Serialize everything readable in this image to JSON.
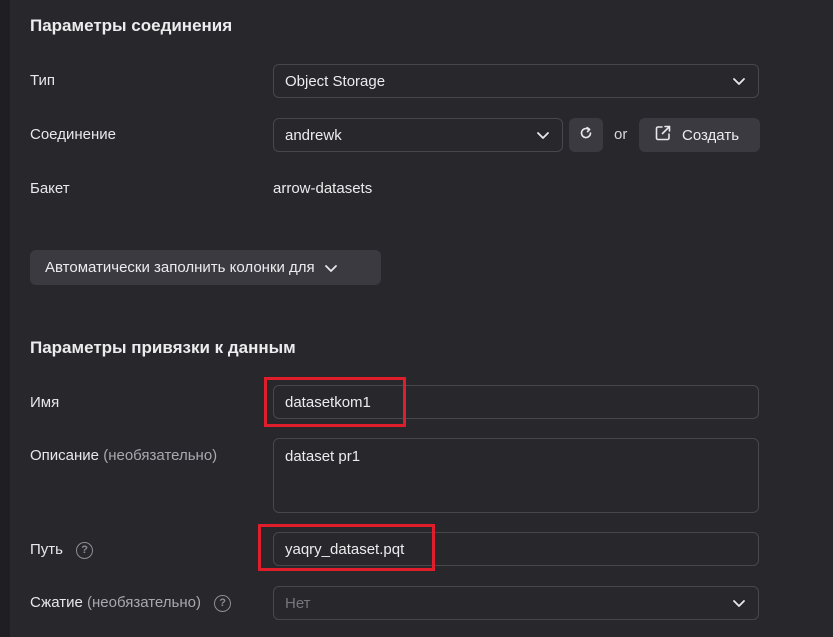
{
  "connection_section": {
    "title": "Параметры соединения",
    "type_label": "Тип",
    "type_value": "Object Storage",
    "connection_label": "Соединение",
    "connection_value": "andrewk",
    "or_text": "or",
    "create_label": "Создать",
    "bucket_label": "Бакет",
    "bucket_value": "arrow-datasets",
    "autofill_label": "Автоматически заполнить колонки для"
  },
  "binding_section": {
    "title": "Параметры привязки к данным",
    "name_label": "Имя",
    "name_value": "datasetkom1",
    "description_label": "Описание",
    "description_optional": "(необязательно)",
    "description_value": "dataset pr1",
    "path_label": "Путь",
    "path_value": "yaqry_dataset.pqt",
    "compression_label": "Сжатие",
    "compression_optional": "(необязательно)",
    "compression_placeholder": "Нет",
    "help_glyph": "?"
  },
  "highlight_color": "#e01d2a",
  "icons": [
    "chevron-down-icon",
    "refresh-icon",
    "external-link-icon",
    "help-icon"
  ]
}
